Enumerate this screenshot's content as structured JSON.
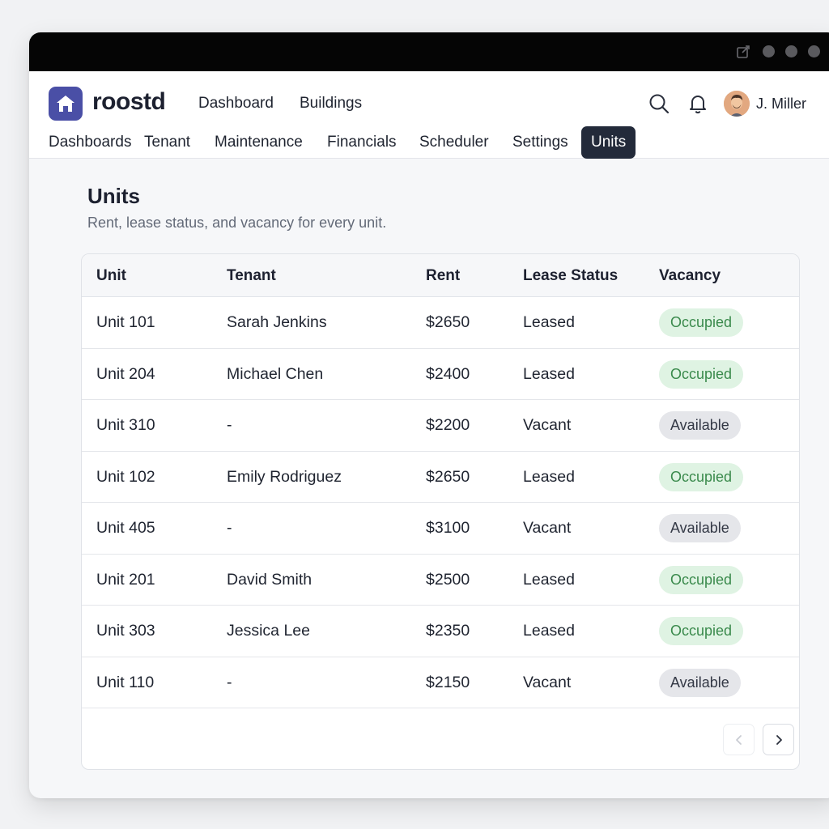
{
  "app": {
    "brand": "roostd",
    "top_nav": [
      "Dashboard",
      "Buildings"
    ],
    "user_name": "J. Miller"
  },
  "tabs": [
    {
      "label": "Dashboards"
    },
    {
      "label": "Tenant"
    },
    {
      "label": "Maintenance"
    },
    {
      "label": "Financials"
    },
    {
      "label": "Scheduler"
    },
    {
      "label": "Settings"
    },
    {
      "label": "Units",
      "active": true
    }
  ],
  "page": {
    "title": "Units",
    "subtitle": "Rent, lease status, and vacancy for every unit."
  },
  "table": {
    "columns": [
      "Unit",
      "Tenant",
      "Rent",
      "Lease Status",
      "Vacancy"
    ],
    "rows": [
      {
        "unit": "Unit 101",
        "tenant": "Sarah Jenkins",
        "rent": "$2650",
        "lease": "Leased",
        "vacancy": "Occupied"
      },
      {
        "unit": "Unit 204",
        "tenant": "Michael Chen",
        "rent": "$2400",
        "lease": "Leased",
        "vacancy": "Occupied"
      },
      {
        "unit": "Unit 310",
        "tenant": "-",
        "rent": "$2200",
        "lease": "Vacant",
        "vacancy": "Available"
      },
      {
        "unit": "Unit 102",
        "tenant": "Emily Rodriguez",
        "rent": "$2650",
        "lease": "Leased",
        "vacancy": "Occupied"
      },
      {
        "unit": "Unit 405",
        "tenant": "-",
        "rent": "$3100",
        "lease": "Vacant",
        "vacancy": "Available"
      },
      {
        "unit": "Unit 201",
        "tenant": "David Smith",
        "rent": "$2500",
        "lease": "Leased",
        "vacancy": "Occupied"
      },
      {
        "unit": "Unit 303",
        "tenant": "Jessica Lee",
        "rent": "$2350",
        "lease": "Leased",
        "vacancy": "Occupied"
      },
      {
        "unit": "Unit 110",
        "tenant": "-",
        "rent": "$2150",
        "lease": "Vacant",
        "vacancy": "Available"
      }
    ]
  },
  "icons": {
    "logo": "home-icon",
    "search": "search-icon",
    "notifications": "bell-icon",
    "window_action": "edit-icon",
    "prev": "chevron-left-icon",
    "next": "chevron-right-icon"
  },
  "colors": {
    "brand": "#4a4fa6",
    "active_tab": "#232a3a",
    "occupied_bg": "#dff3e3",
    "occupied_text": "#3a8a4c",
    "available_bg": "#e5e6ea"
  }
}
